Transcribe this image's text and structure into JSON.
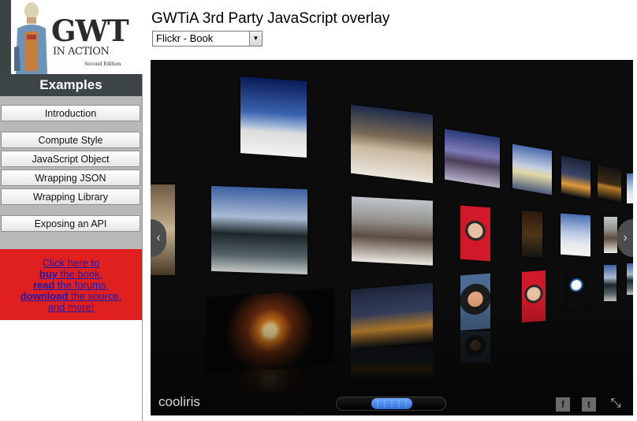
{
  "logo": {
    "title": "GWT",
    "subtitle": "IN ACTION",
    "edition": "Second Edition"
  },
  "sidebar": {
    "header": "Examples",
    "items": [
      {
        "label": "Introduction"
      },
      {
        "label": "Compute Style"
      },
      {
        "label": "JavaScript Object"
      },
      {
        "label": "Wrapping JSON"
      },
      {
        "label": "Wrapping Library"
      },
      {
        "label": "Exposing an API"
      }
    ],
    "promo": {
      "line1": "Click here to",
      "buy": "buy",
      "buy_rest": " the book,",
      "read": "read",
      "read_rest": " the forums,",
      "download": "download",
      "download_rest": " the source,",
      "line5": "and more!"
    }
  },
  "main": {
    "title": "GWTiA 3rd Party JavaScript overlay",
    "select": {
      "value": "Flickr - Book",
      "arrow": "▼"
    }
  },
  "viewer": {
    "brand": "cooliris",
    "prev_arrow": "‹",
    "next_arrow": "›",
    "facebook": "f",
    "twitter": "t",
    "fullscreen": "⤡"
  }
}
